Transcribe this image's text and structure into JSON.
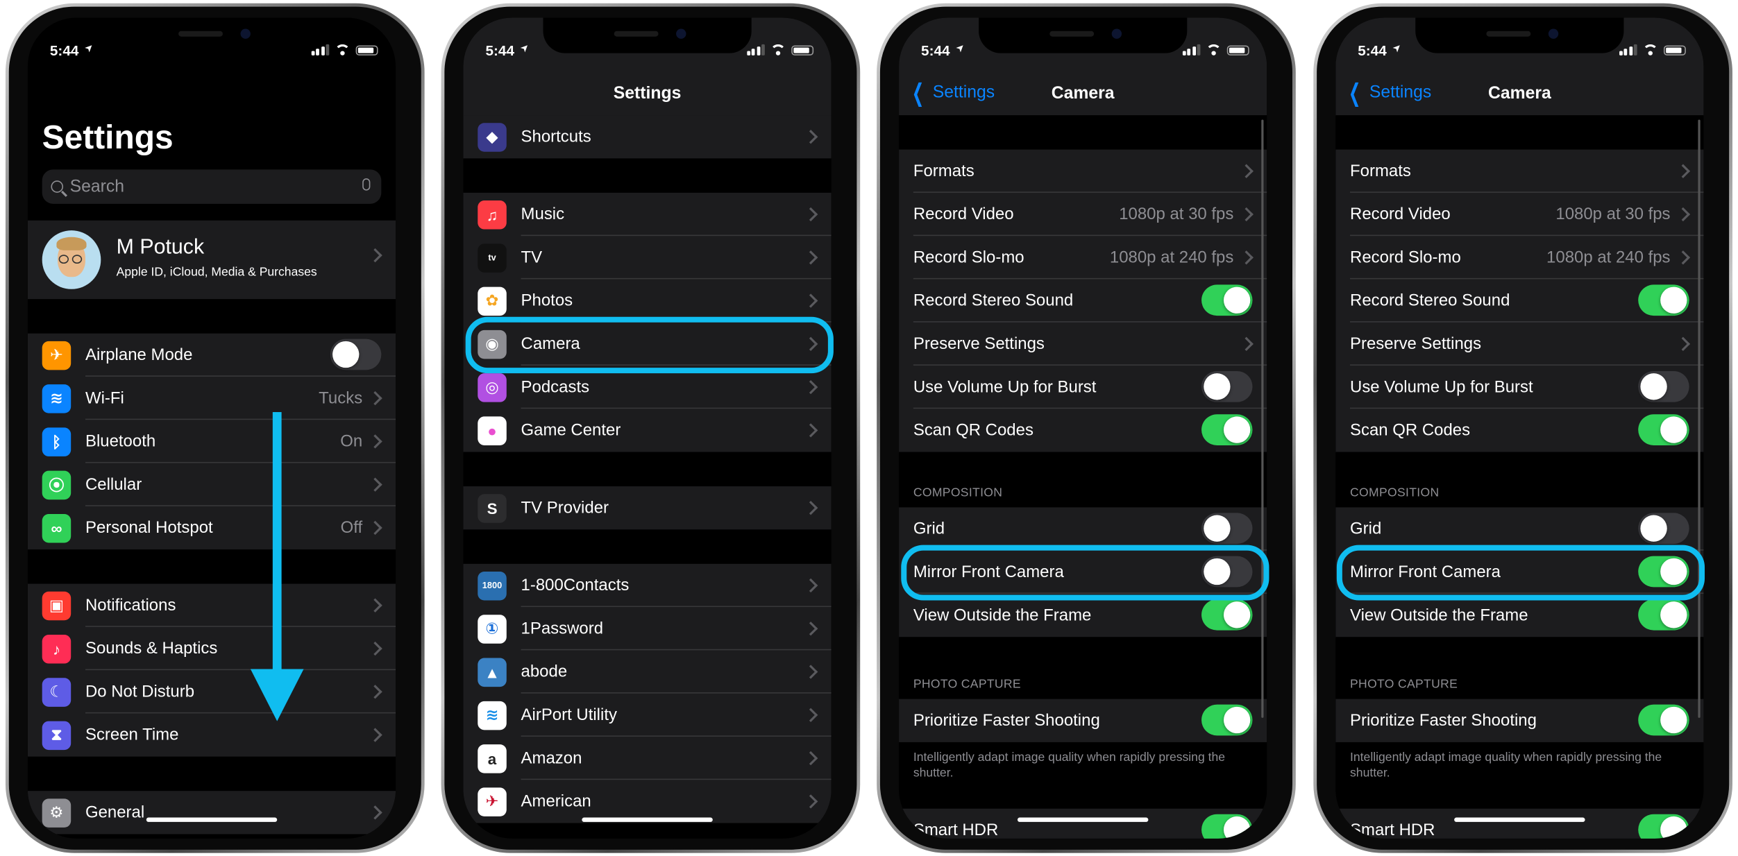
{
  "status_bar": {
    "time": "5:44"
  },
  "colors": {
    "highlight": "#10bdf0",
    "toggle_on": "#30d158",
    "link": "#0a84ff",
    "row_bg": "#1c1c1e"
  },
  "phones": [
    {
      "large_title": "Settings",
      "search_placeholder": "Search",
      "profile": {
        "name": "M Potuck",
        "subtitle": "Apple ID, iCloud, Media & Purchases"
      },
      "sections": [
        {
          "rows": [
            {
              "label": "Airplane Mode",
              "icon": "airplane-icon",
              "icon_color": "#ff9500",
              "control": "toggle",
              "on": false
            },
            {
              "label": "Wi-Fi",
              "icon": "wifi-icon",
              "icon_color": "#0a84ff",
              "value": "Tucks",
              "control": "chevron"
            },
            {
              "label": "Bluetooth",
              "icon": "bluetooth-icon",
              "icon_color": "#0a84ff",
              "value": "On",
              "control": "chevron"
            },
            {
              "label": "Cellular",
              "icon": "cellular-icon",
              "icon_color": "#30d158",
              "control": "chevron"
            },
            {
              "label": "Personal Hotspot",
              "icon": "hotspot-icon",
              "icon_color": "#30d158",
              "value": "Off",
              "control": "chevron"
            }
          ]
        },
        {
          "rows": [
            {
              "label": "Notifications",
              "icon": "notifications-icon",
              "icon_color": "#ff3b30",
              "control": "chevron"
            },
            {
              "label": "Sounds & Haptics",
              "icon": "speaker-icon",
              "icon_color": "#ff2d55",
              "control": "chevron"
            },
            {
              "label": "Do Not Disturb",
              "icon": "moon-icon",
              "icon_color": "#5e5ce6",
              "control": "chevron"
            },
            {
              "label": "Screen Time",
              "icon": "hourglass-icon",
              "icon_color": "#5e5ce6",
              "control": "chevron"
            }
          ]
        },
        {
          "rows": [
            {
              "label": "General",
              "icon": "gear-icon",
              "icon_color": "#8e8e93",
              "control": "chevron"
            }
          ]
        }
      ]
    },
    {
      "nav_title": "Settings",
      "sections": [
        {
          "no_gap": true,
          "rows": [
            {
              "label": "Shortcuts",
              "icon": "shortcuts-icon",
              "icon_color": "#3a3a8c",
              "control": "chevron"
            }
          ]
        },
        {
          "rows": [
            {
              "label": "Music",
              "icon": "music-icon",
              "icon_color": "#fc3c44",
              "control": "chevron"
            },
            {
              "label": "TV",
              "icon": "tv-icon",
              "icon_color": "#111111",
              "control": "chevron"
            },
            {
              "label": "Photos",
              "icon": "photos-icon",
              "icon_color": "#ffffff",
              "control": "chevron"
            },
            {
              "label": "Camera",
              "icon": "camera-icon",
              "icon_color": "#8e8e93",
              "control": "chevron"
            },
            {
              "label": "Podcasts",
              "icon": "podcasts-icon",
              "icon_color": "#b150e2",
              "control": "chevron"
            },
            {
              "label": "Game Center",
              "icon": "game-center-icon",
              "icon_color": "#ffffff",
              "control": "chevron"
            }
          ]
        },
        {
          "rows": [
            {
              "label": "TV Provider",
              "icon": "tv-provider-icon",
              "icon_color": "#2c2c2e",
              "control": "chevron"
            }
          ]
        },
        {
          "rows": [
            {
              "label": "1-800Contacts",
              "icon": "contacts-1800-icon",
              "icon_color": "#2a6fb0",
              "control": "chevron"
            },
            {
              "label": "1Password",
              "icon": "1password-icon",
              "icon_color": "#ffffff",
              "control": "chevron"
            },
            {
              "label": "abode",
              "icon": "abode-icon",
              "icon_color": "#3b82c4",
              "control": "chevron"
            },
            {
              "label": "AirPort Utility",
              "icon": "airport-utility-icon",
              "icon_color": "#ffffff",
              "control": "chevron"
            },
            {
              "label": "Amazon",
              "icon": "amazon-icon",
              "icon_color": "#ffffff",
              "control": "chevron"
            },
            {
              "label": "American",
              "icon": "american-icon",
              "icon_color": "#ffffff",
              "control": "chevron"
            }
          ]
        }
      ]
    },
    {
      "nav_title": "Camera",
      "back_label": "Settings",
      "sections": [
        {
          "rows": [
            {
              "label": "Formats",
              "control": "chevron"
            },
            {
              "label": "Record Video",
              "value": "1080p at 30 fps",
              "control": "chevron"
            },
            {
              "label": "Record Slo-mo",
              "value": "1080p at 240 fps",
              "control": "chevron"
            },
            {
              "label": "Record Stereo Sound",
              "control": "toggle",
              "on": true
            },
            {
              "label": "Preserve Settings",
              "control": "chevron"
            },
            {
              "label": "Use Volume Up for Burst",
              "control": "toggle",
              "on": false
            },
            {
              "label": "Scan QR Codes",
              "control": "toggle",
              "on": true
            }
          ]
        },
        {
          "header": "COMPOSITION",
          "rows": [
            {
              "label": "Grid",
              "control": "toggle",
              "on": false
            },
            {
              "label": "Mirror Front Camera",
              "control": "toggle",
              "on": false
            },
            {
              "label": "View Outside the Frame",
              "control": "toggle",
              "on": true
            }
          ]
        },
        {
          "header": "PHOTO CAPTURE",
          "tall": true,
          "footer": "Intelligently adapt image quality when rapidly pressing the shutter.",
          "rows": [
            {
              "label": "Prioritize Faster Shooting",
              "control": "toggle",
              "on": true
            }
          ]
        },
        {
          "no_gap": true,
          "rows": [
            {
              "label": "Smart HDR",
              "control": "toggle",
              "on": true
            }
          ]
        }
      ]
    },
    {
      "nav_title": "Camera",
      "back_label": "Settings",
      "sections": [
        {
          "rows": [
            {
              "label": "Formats",
              "control": "chevron"
            },
            {
              "label": "Record Video",
              "value": "1080p at 30 fps",
              "control": "chevron"
            },
            {
              "label": "Record Slo-mo",
              "value": "1080p at 240 fps",
              "control": "chevron"
            },
            {
              "label": "Record Stereo Sound",
              "control": "toggle",
              "on": true
            },
            {
              "label": "Preserve Settings",
              "control": "chevron"
            },
            {
              "label": "Use Volume Up for Burst",
              "control": "toggle",
              "on": false
            },
            {
              "label": "Scan QR Codes",
              "control": "toggle",
              "on": true
            }
          ]
        },
        {
          "header": "COMPOSITION",
          "rows": [
            {
              "label": "Grid",
              "control": "toggle",
              "on": false
            },
            {
              "label": "Mirror Front Camera",
              "control": "toggle",
              "on": true
            },
            {
              "label": "View Outside the Frame",
              "control": "toggle",
              "on": true
            }
          ]
        },
        {
          "header": "PHOTO CAPTURE",
          "tall": true,
          "footer": "Intelligently adapt image quality when rapidly pressing the shutter.",
          "rows": [
            {
              "label": "Prioritize Faster Shooting",
              "control": "toggle",
              "on": true
            }
          ]
        },
        {
          "no_gap": true,
          "rows": [
            {
              "label": "Smart HDR",
              "control": "toggle",
              "on": true
            }
          ]
        }
      ]
    }
  ],
  "annotations": [
    {
      "type": "arrow",
      "meaning": "scroll-down"
    },
    {
      "type": "highlight",
      "target": "Camera"
    },
    {
      "type": "highlight",
      "target": "Mirror Front Camera (off)"
    },
    {
      "type": "highlight",
      "target": "Mirror Front Camera (on)"
    }
  ]
}
